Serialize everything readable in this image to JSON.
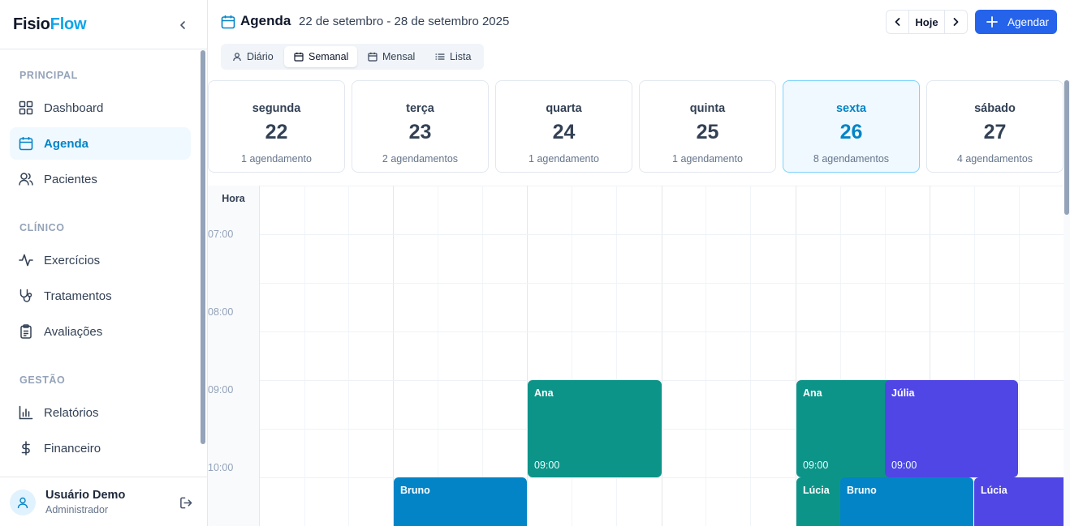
{
  "sidebar": {
    "brand_a": "Fisio",
    "brand_b": "Flow",
    "sections": [
      {
        "label": "PRINCIPAL"
      },
      {
        "label": "CLÍNICO"
      },
      {
        "label": "GESTÃO"
      }
    ],
    "items": [
      {
        "label": "Dashboard",
        "icon": "grid-icon"
      },
      {
        "label": "Agenda",
        "icon": "calendar-icon",
        "active": true
      },
      {
        "label": "Pacientes",
        "icon": "users-icon"
      },
      {
        "label": "Exercícios",
        "icon": "activity-icon"
      },
      {
        "label": "Tratamentos",
        "icon": "stethoscope-icon"
      },
      {
        "label": "Avaliações",
        "icon": "clipboard-icon"
      },
      {
        "label": "Relatórios",
        "icon": "bar-chart-icon"
      },
      {
        "label": "Financeiro",
        "icon": "dollar-icon"
      }
    ],
    "user": {
      "name": "Usuário Demo",
      "role": "Administrador"
    }
  },
  "header": {
    "title": "Agenda",
    "range": "22 de setembro - 28 de setembro 2025",
    "today_label": "Hoje",
    "new_label": "Agendar"
  },
  "views": {
    "tabs": [
      {
        "label": "Diário",
        "icon": "user-icon"
      },
      {
        "label": "Semanal",
        "icon": "calendar-icon",
        "active": true
      },
      {
        "label": "Mensal",
        "icon": "calendar-icon"
      },
      {
        "label": "Lista",
        "icon": "list-icon"
      }
    ]
  },
  "days": [
    {
      "name": "segunda",
      "date": "22",
      "count": "1 agendamento"
    },
    {
      "name": "terça",
      "date": "23",
      "count": "2 agendamentos"
    },
    {
      "name": "quarta",
      "date": "24",
      "count": "1 agendamento"
    },
    {
      "name": "quinta",
      "date": "25",
      "count": "1 agendamento"
    },
    {
      "name": "sexta",
      "date": "26",
      "count": "8 agendamentos",
      "today": true
    },
    {
      "name": "sábado",
      "date": "27",
      "count": "4 agendamentos"
    }
  ],
  "grid": {
    "hour_header": "Hora",
    "hours": [
      "07:00",
      "08:00",
      "09:00",
      "10:00"
    ]
  },
  "appointments": [
    {
      "name": "Ana",
      "time": "09:00",
      "color": "#0d9488"
    },
    {
      "name": "Ana",
      "time": "09:00",
      "color": "#0d9488"
    },
    {
      "name": "Júlia",
      "time": "09:00",
      "color": "#4f46e5"
    },
    {
      "name": "Bruno",
      "time": "",
      "color": "#0284c7"
    },
    {
      "name": "Lúcia",
      "time": "",
      "color": "#0d9488"
    },
    {
      "name": "Bruno",
      "time": "",
      "color": "#0284c7"
    },
    {
      "name": "Lúcia",
      "time": "",
      "color": "#4f46e5"
    }
  ]
}
